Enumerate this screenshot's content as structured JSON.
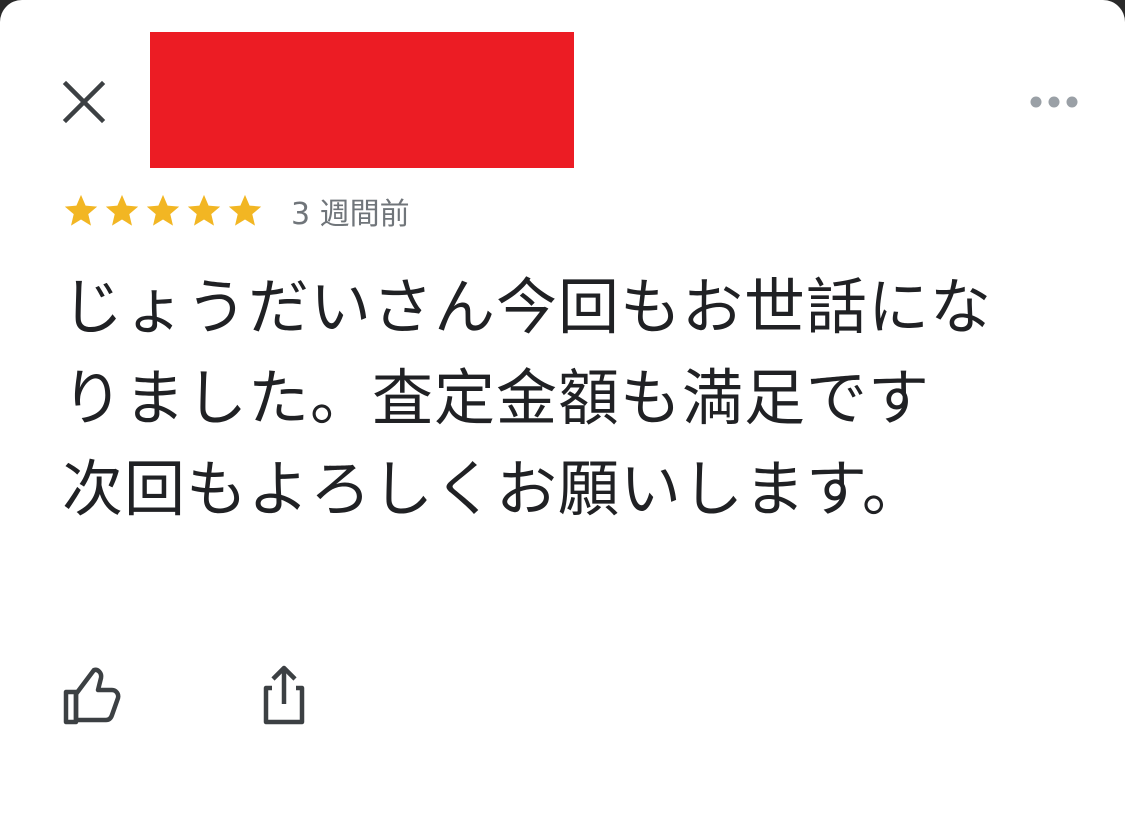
{
  "header": {
    "close_icon": "close-icon",
    "more_icon": "more-horizontal-icon",
    "redaction_color": "#ec1c24"
  },
  "review": {
    "rating": 5,
    "rating_max": 5,
    "star_color": "#f2b623",
    "time_ago": "3 週間前",
    "text": "じょうだいさん今回もお世話になりました。査定金額も満足です\n次回もよろしくお願いします。"
  },
  "actions": {
    "like_icon": "thumbs-up-icon",
    "share_icon": "share-icon"
  }
}
